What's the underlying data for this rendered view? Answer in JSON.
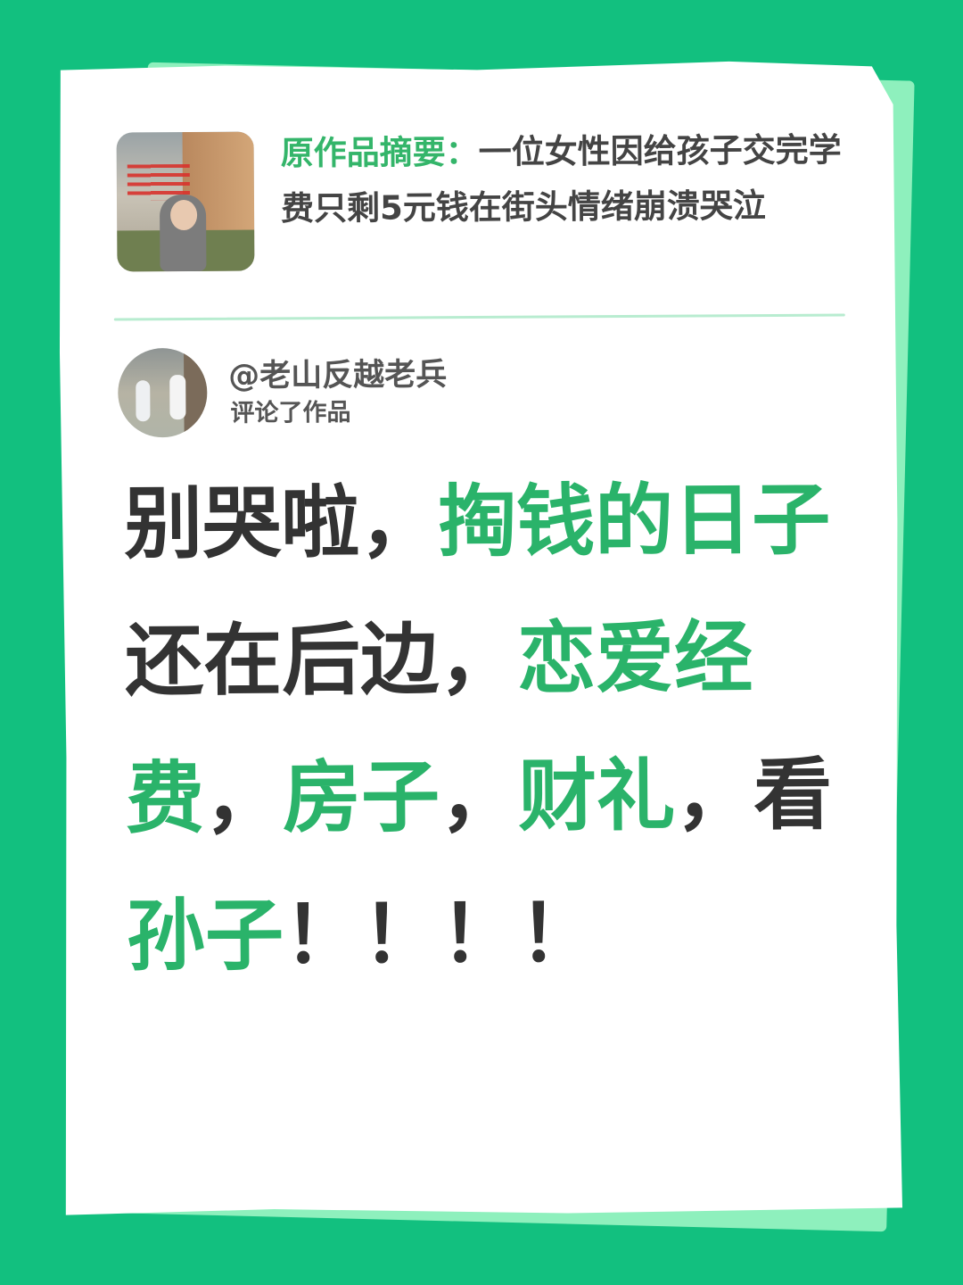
{
  "colors": {
    "background": "#12c07f",
    "accent_green": "#2ab36a",
    "text_dark": "#333333"
  },
  "summary": {
    "label": "原作品摘要：",
    "text": "一位女性因给孩子交完学费只剩5元钱在街头情绪崩溃哭泣"
  },
  "commenter": {
    "name": "@老山反越老兵",
    "action": "评论了作品"
  },
  "comment": {
    "segments": [
      {
        "text": "别哭啦，",
        "highlight": false
      },
      {
        "text": "掏钱的日子",
        "highlight": true
      },
      {
        "text": "还在后边，",
        "highlight": false
      },
      {
        "text": "恋爱经费",
        "highlight": true
      },
      {
        "text": "，",
        "highlight": false
      },
      {
        "text": "房子",
        "highlight": true
      },
      {
        "text": "，",
        "highlight": false
      },
      {
        "text": "财礼",
        "highlight": true
      },
      {
        "text": "，看",
        "highlight": false
      },
      {
        "text": "孙子",
        "highlight": true
      },
      {
        "text": "！！！！",
        "highlight": false
      }
    ]
  }
}
